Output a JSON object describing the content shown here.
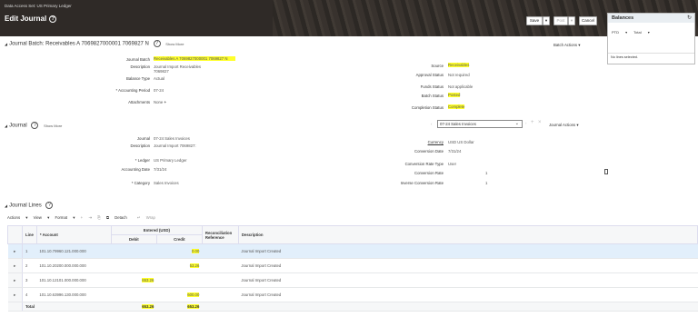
{
  "header": {
    "data_access_label": "Data Access Set:",
    "data_access_value": "US Primary Ledger",
    "page_title": "Edit Journal",
    "buttons": {
      "save": "Save",
      "post": "Post",
      "cancel": "Cancel"
    }
  },
  "balances_panel": {
    "title": "Balances",
    "ptd_label": "PTD",
    "total_label": "Total",
    "empty_text": "No lines selected."
  },
  "batch": {
    "section_title": "Journal Batch: Receivables A 7069827000001 7069827 N",
    "show_more": "Show More",
    "batch_actions": "Batch Actions",
    "labels": {
      "journal_batch": "Journal Batch",
      "description": "Description",
      "balance_type": "Balance Type",
      "accounting_period": "Accounting Period",
      "attachments": "Attachments",
      "source": "Source",
      "approval_status": "Approval Status",
      "funds_status": "Funds Status",
      "batch_status": "Batch Status",
      "completion_status": "Completion Status"
    },
    "values": {
      "journal_batch": "Receivables A 7069827000001 7069827 N",
      "description": "Journal Import Receivables 7069827",
      "balance_type": "Actual",
      "accounting_period": "07-24",
      "attachments": "None",
      "source": "Receivables",
      "approval_status": "Not required",
      "funds_status": "Not applicable",
      "batch_status": "Posted",
      "completion_status": "Complete"
    }
  },
  "journal": {
    "section_title": "Journal",
    "show_more": "Show More",
    "selected_journal": "07-24 Sales Invoices",
    "journal_actions": "Journal Actions",
    "labels": {
      "journal": "Journal",
      "description": "Description",
      "ledger": "Ledger",
      "accounting_date": "Accounting Date",
      "category": "Category",
      "currency": "Currency",
      "conversion_date": "Conversion Date",
      "conversion_rate_type": "Conversion Rate Type",
      "conversion_rate": "Conversion Rate",
      "inverse_conversion_rate": "Inverse Conversion Rate"
    },
    "values": {
      "journal": "07-24 Sales Invoices",
      "description": "Journal Import 7069827:",
      "ledger": "US Primary Ledger",
      "accounting_date": "7/31/24",
      "category": "Sales Invoices",
      "currency": "USD US Dollar",
      "conversion_date": "7/31/24",
      "conversion_rate_type": "User",
      "conversion_rate": "1",
      "inverse_conversion_rate": "1"
    }
  },
  "lines": {
    "section_title": "Journal Lines",
    "toolbar": {
      "actions": "Actions",
      "view": "View",
      "format": "Format",
      "detach": "Detach",
      "wrap": "Wrap"
    },
    "headers": {
      "line": "Line",
      "account": "Account",
      "entered": "Entered (USD)",
      "debit": "Debit",
      "credit": "Credit",
      "reconciliation": "Reconciliation Reference",
      "description": "Description"
    },
    "rows": [
      {
        "line": "1",
        "account": "101.10.79960.121.000.000",
        "debit": "",
        "credit": "0.00",
        "description": "Journal Import Created"
      },
      {
        "line": "2",
        "account": "101.10.20200.000.000.000",
        "debit": "",
        "credit": "53.26",
        "description": "Journal Import Created"
      },
      {
        "line": "3",
        "account": "101.10.12101.000.000.000",
        "debit": "653.26",
        "credit": "",
        "description": "Journal Import Created"
      },
      {
        "line": "4",
        "account": "101.10.63996.130.000.000",
        "debit": "",
        "credit": "600.00",
        "description": "Journal Import Created"
      }
    ],
    "total_label": "Total",
    "total_debit": "653.26",
    "total_credit": "653.26"
  }
}
